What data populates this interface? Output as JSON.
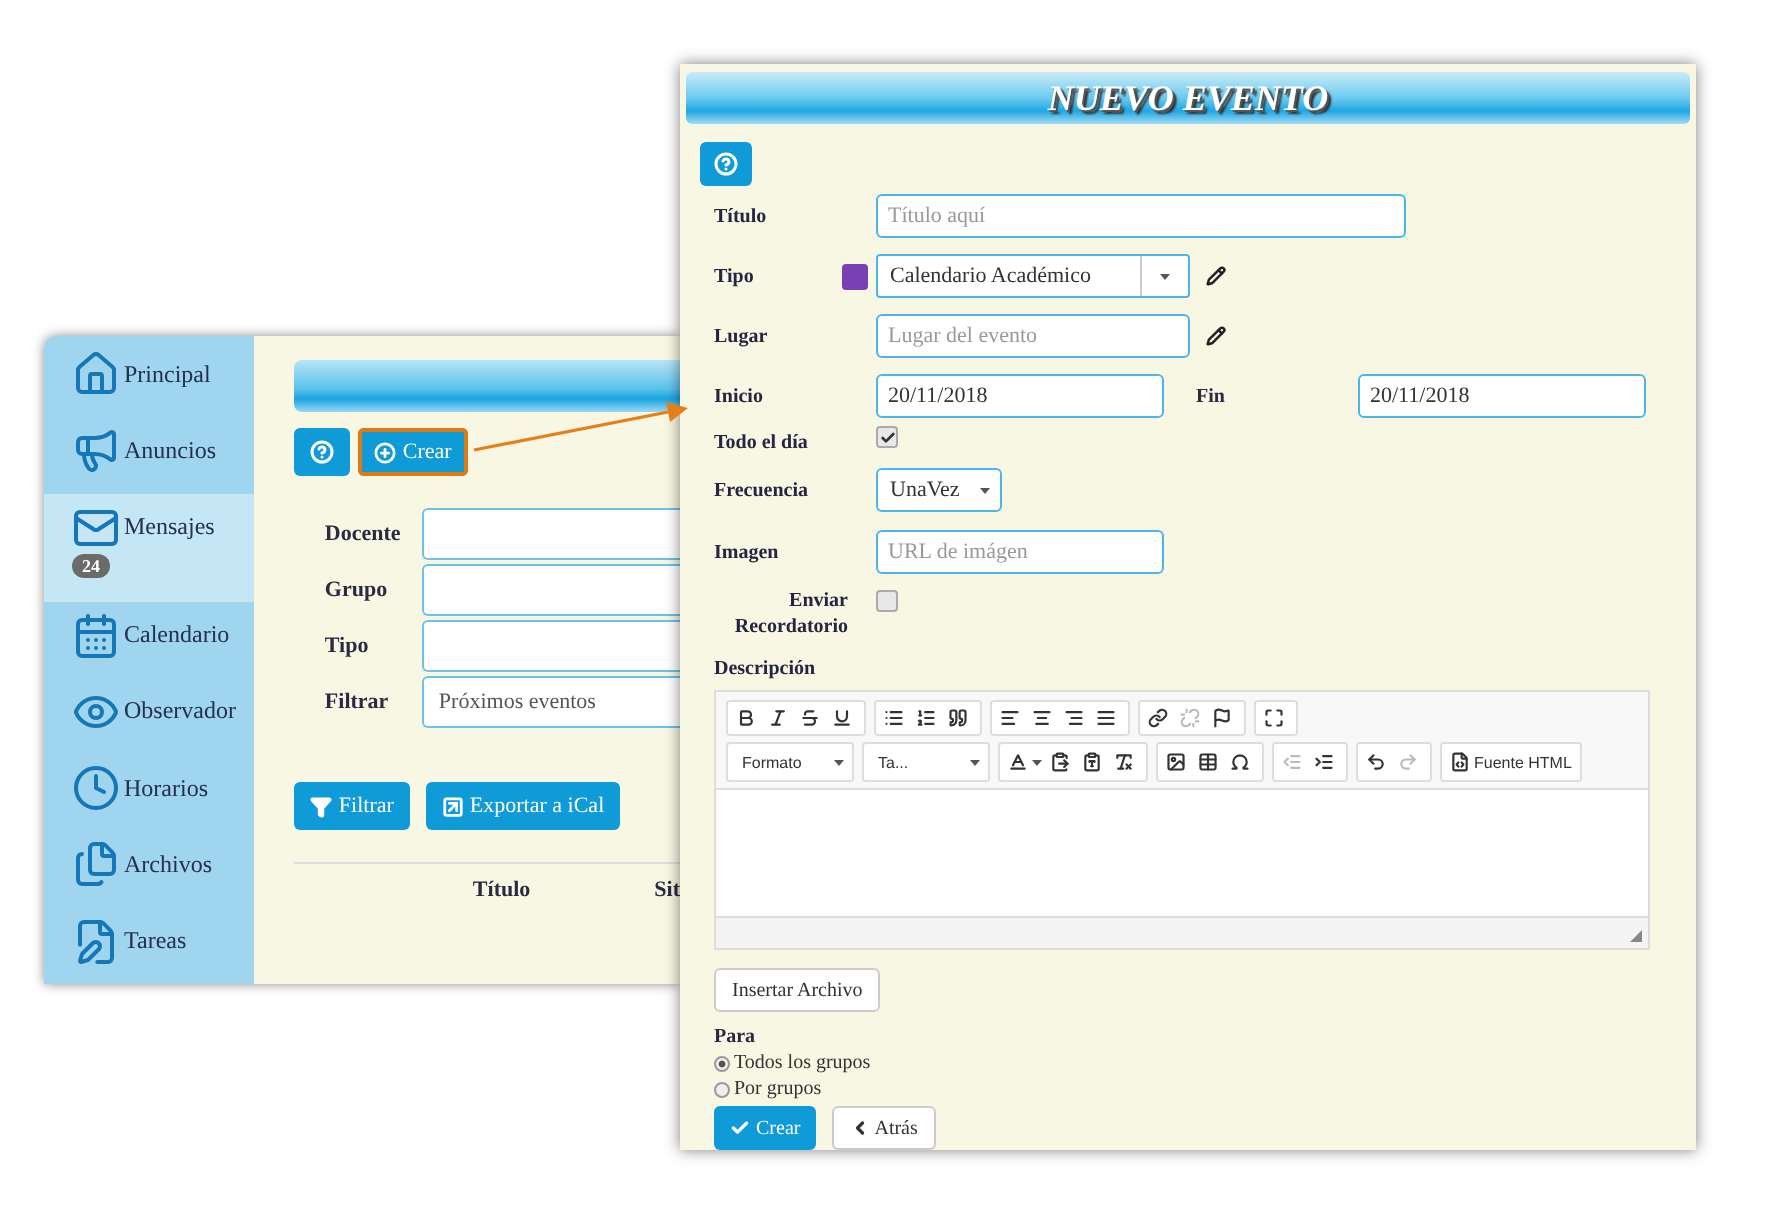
{
  "background_screen": {
    "sidebar": [
      {
        "label": "Principal",
        "selected": false
      },
      {
        "label": "Anuncios",
        "selected": false
      },
      {
        "label": "Mensajes",
        "selected": true,
        "badge": "24"
      },
      {
        "label": "Calendario",
        "selected": false
      },
      {
        "label": "Observador",
        "selected": false
      },
      {
        "label": "Horarios",
        "selected": false
      },
      {
        "label": "Archivos",
        "selected": false
      },
      {
        "label": "Tareas",
        "selected": false
      }
    ],
    "actions": [
      {
        "kind": "help",
        "highlighted": false
      },
      {
        "kind": "create",
        "label": "Crear",
        "highlighted": true
      }
    ],
    "filters": [
      {
        "label": "Docente"
      },
      {
        "label": "Grupo"
      },
      {
        "label": "Tipo"
      },
      {
        "label": "Filtrar",
        "value": "Próximos eventos"
      }
    ],
    "buttons": [
      {
        "kind": "filter",
        "label": "Filtrar"
      },
      {
        "kind": "export",
        "label": "Exportar a iCal"
      }
    ],
    "table": {
      "columns": [
        "Título",
        "Sit"
      ]
    }
  },
  "event_form": {
    "title": "NUEVO EVENTO",
    "title_field": {
      "label": "Título",
      "placeholder": "Título aquí"
    },
    "type_field": {
      "label": "Tipo",
      "color": "#7b3fb5",
      "value": "Calendario Académico"
    },
    "place_field": {
      "label": "Lugar",
      "placeholder": "Lugar del evento"
    },
    "start_field": {
      "label": "Inicio",
      "value": "20/11/2018"
    },
    "end_field": {
      "label": "Fin",
      "value": "20/11/2018"
    },
    "all_day": {
      "label": "Todo el día",
      "checked": true
    },
    "frequency": {
      "label": "Frecuencia",
      "value": "UnaVez"
    },
    "image_field": {
      "label": "Imagen",
      "placeholder": "URL de imágen"
    },
    "reminder": {
      "label": "Enviar Recordatorio",
      "checked": false
    },
    "description": {
      "label": "Descripción",
      "toolbar": [
        [
          [
            {
              "kind": "bold",
              "disabled": false
            },
            {
              "kind": "italic",
              "disabled": false
            },
            {
              "kind": "strike",
              "disabled": false
            },
            {
              "kind": "underline",
              "disabled": false
            }
          ],
          [
            {
              "kind": "bullets",
              "disabled": false
            },
            {
              "kind": "numbering",
              "disabled": false
            },
            {
              "kind": "quote",
              "disabled": false
            }
          ],
          [
            {
              "kind": "align_left",
              "disabled": false
            },
            {
              "kind": "align_center",
              "disabled": false
            },
            {
              "kind": "align_right",
              "disabled": false
            },
            {
              "kind": "justify",
              "disabled": false
            }
          ],
          [
            {
              "kind": "link",
              "disabled": false
            },
            {
              "kind": "unlink",
              "disabled": true
            },
            {
              "kind": "flag",
              "disabled": false
            }
          ],
          [
            {
              "kind": "maximize",
              "disabled": false
            }
          ]
        ],
        [
          [
            {
              "kind": "dropdown",
              "label": "Formato",
              "disabled": false
            }
          ],
          [
            {
              "kind": "dropdown",
              "label": "Ta...",
              "disabled": false
            }
          ],
          [
            {
              "kind": "text_color",
              "disabled": false
            },
            {
              "kind": "paste",
              "disabled": false
            },
            {
              "kind": "paste_text",
              "disabled": false
            },
            {
              "kind": "clear_format",
              "disabled": false
            }
          ],
          [
            {
              "kind": "image",
              "disabled": false
            },
            {
              "kind": "table",
              "disabled": false
            },
            {
              "kind": "special_char",
              "disabled": false
            }
          ],
          [
            {
              "kind": "outdent",
              "disabled": true
            },
            {
              "kind": "indent",
              "disabled": false
            }
          ],
          [
            {
              "kind": "undo",
              "disabled": false
            },
            {
              "kind": "redo",
              "disabled": true
            }
          ],
          [
            {
              "kind": "source",
              "label": "Fuente HTML",
              "disabled": false
            }
          ]
        ]
      ]
    },
    "insert_file_button": "Insertar Archivo",
    "recipients": {
      "label": "Para",
      "options": [
        {
          "label": "Todos los grupos",
          "selected": true
        },
        {
          "label": "Por grupos",
          "selected": false
        }
      ]
    },
    "buttons": [
      {
        "kind": "primary",
        "label": "Crear"
      },
      {
        "kind": "back",
        "label": "Atrás"
      }
    ]
  }
}
